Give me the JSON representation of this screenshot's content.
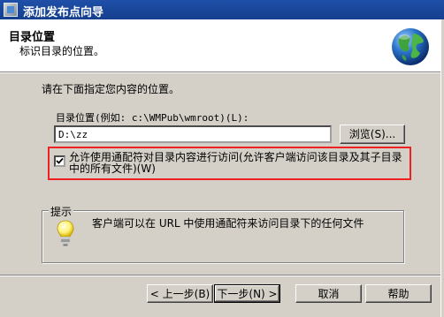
{
  "window": {
    "title": "添加发布点向导"
  },
  "header": {
    "title": "目录位置",
    "subtitle": "标识目录的位置。",
    "icon": "globe-icon"
  },
  "main": {
    "instruction": "请在下面指定您内容的位置。",
    "field_label": "目录位置(例如: c:\\WMPub\\wmroot)(L):",
    "path_value": "D:\\zz",
    "browse_label": "浏览(S)...",
    "wildcard_checkbox": {
      "checked": true,
      "label": "允许使用通配符对目录内容进行访问(允许客户端访问该目录及其子目录中的所有文件)(W)"
    },
    "tip": {
      "legend": "提示",
      "icon": "lightbulb-icon",
      "text": "客户端可以在 URL 中使用通配符来访问目录下的任何文件"
    }
  },
  "footer": {
    "back_label": "< 上一步(B)",
    "next_label": "下一步(N) >",
    "cancel_label": "取消",
    "help_label": "帮助"
  },
  "colors": {
    "titlebar": "#1f4fa8",
    "dialog_background": "#d4d0c8",
    "highlight_border": "#ee2222"
  }
}
